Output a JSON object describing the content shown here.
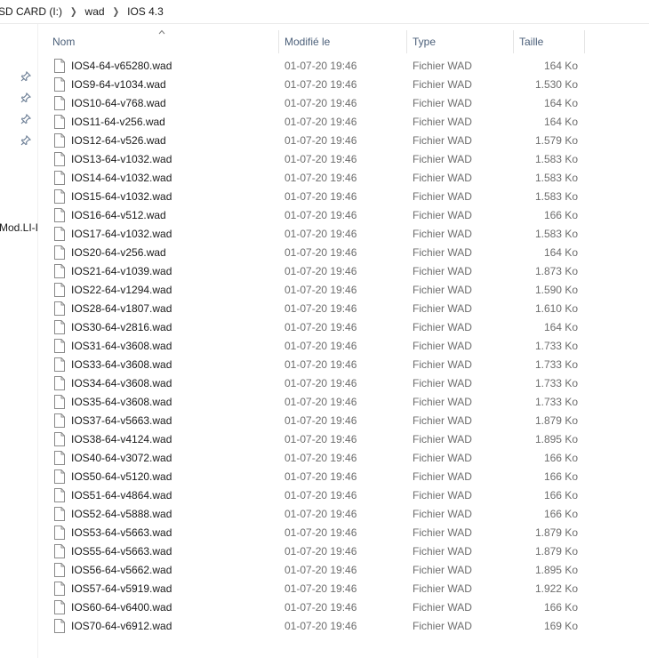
{
  "breadcrumb": [
    "SD CARD (I:)",
    "wad",
    "IOS 4.3"
  ],
  "nav": {
    "partial_label": "Mod.LI-I",
    "pins": 4
  },
  "columns": {
    "name": "Nom",
    "modified": "Modifié le",
    "type": "Type",
    "size": "Taille"
  },
  "files": [
    {
      "name": "IOS4-64-v65280.wad",
      "modified": "01-07-20 19:46",
      "type": "Fichier WAD",
      "size": "164 Ko"
    },
    {
      "name": "IOS9-64-v1034.wad",
      "modified": "01-07-20 19:46",
      "type": "Fichier WAD",
      "size": "1.530 Ko"
    },
    {
      "name": "IOS10-64-v768.wad",
      "modified": "01-07-20 19:46",
      "type": "Fichier WAD",
      "size": "164 Ko"
    },
    {
      "name": "IOS11-64-v256.wad",
      "modified": "01-07-20 19:46",
      "type": "Fichier WAD",
      "size": "164 Ko"
    },
    {
      "name": "IOS12-64-v526.wad",
      "modified": "01-07-20 19:46",
      "type": "Fichier WAD",
      "size": "1.579 Ko"
    },
    {
      "name": "IOS13-64-v1032.wad",
      "modified": "01-07-20 19:46",
      "type": "Fichier WAD",
      "size": "1.583 Ko"
    },
    {
      "name": "IOS14-64-v1032.wad",
      "modified": "01-07-20 19:46",
      "type": "Fichier WAD",
      "size": "1.583 Ko"
    },
    {
      "name": "IOS15-64-v1032.wad",
      "modified": "01-07-20 19:46",
      "type": "Fichier WAD",
      "size": "1.583 Ko"
    },
    {
      "name": "IOS16-64-v512.wad",
      "modified": "01-07-20 19:46",
      "type": "Fichier WAD",
      "size": "166 Ko"
    },
    {
      "name": "IOS17-64-v1032.wad",
      "modified": "01-07-20 19:46",
      "type": "Fichier WAD",
      "size": "1.583 Ko"
    },
    {
      "name": "IOS20-64-v256.wad",
      "modified": "01-07-20 19:46",
      "type": "Fichier WAD",
      "size": "164 Ko"
    },
    {
      "name": "IOS21-64-v1039.wad",
      "modified": "01-07-20 19:46",
      "type": "Fichier WAD",
      "size": "1.873 Ko"
    },
    {
      "name": "IOS22-64-v1294.wad",
      "modified": "01-07-20 19:46",
      "type": "Fichier WAD",
      "size": "1.590 Ko"
    },
    {
      "name": "IOS28-64-v1807.wad",
      "modified": "01-07-20 19:46",
      "type": "Fichier WAD",
      "size": "1.610 Ko"
    },
    {
      "name": "IOS30-64-v2816.wad",
      "modified": "01-07-20 19:46",
      "type": "Fichier WAD",
      "size": "164 Ko"
    },
    {
      "name": "IOS31-64-v3608.wad",
      "modified": "01-07-20 19:46",
      "type": "Fichier WAD",
      "size": "1.733 Ko"
    },
    {
      "name": "IOS33-64-v3608.wad",
      "modified": "01-07-20 19:46",
      "type": "Fichier WAD",
      "size": "1.733 Ko"
    },
    {
      "name": "IOS34-64-v3608.wad",
      "modified": "01-07-20 19:46",
      "type": "Fichier WAD",
      "size": "1.733 Ko"
    },
    {
      "name": "IOS35-64-v3608.wad",
      "modified": "01-07-20 19:46",
      "type": "Fichier WAD",
      "size": "1.733 Ko"
    },
    {
      "name": "IOS37-64-v5663.wad",
      "modified": "01-07-20 19:46",
      "type": "Fichier WAD",
      "size": "1.879 Ko"
    },
    {
      "name": "IOS38-64-v4124.wad",
      "modified": "01-07-20 19:46",
      "type": "Fichier WAD",
      "size": "1.895 Ko"
    },
    {
      "name": "IOS40-64-v3072.wad",
      "modified": "01-07-20 19:46",
      "type": "Fichier WAD",
      "size": "166 Ko"
    },
    {
      "name": "IOS50-64-v5120.wad",
      "modified": "01-07-20 19:46",
      "type": "Fichier WAD",
      "size": "166 Ko"
    },
    {
      "name": "IOS51-64-v4864.wad",
      "modified": "01-07-20 19:46",
      "type": "Fichier WAD",
      "size": "166 Ko"
    },
    {
      "name": "IOS52-64-v5888.wad",
      "modified": "01-07-20 19:46",
      "type": "Fichier WAD",
      "size": "166 Ko"
    },
    {
      "name": "IOS53-64-v5663.wad",
      "modified": "01-07-20 19:46",
      "type": "Fichier WAD",
      "size": "1.879 Ko"
    },
    {
      "name": "IOS55-64-v5663.wad",
      "modified": "01-07-20 19:46",
      "type": "Fichier WAD",
      "size": "1.879 Ko"
    },
    {
      "name": "IOS56-64-v5662.wad",
      "modified": "01-07-20 19:46",
      "type": "Fichier WAD",
      "size": "1.895 Ko"
    },
    {
      "name": "IOS57-64-v5919.wad",
      "modified": "01-07-20 19:46",
      "type": "Fichier WAD",
      "size": "1.922 Ko"
    },
    {
      "name": "IOS60-64-v6400.wad",
      "modified": "01-07-20 19:46",
      "type": "Fichier WAD",
      "size": "166 Ko"
    },
    {
      "name": "IOS70-64-v6912.wad",
      "modified": "01-07-20 19:46",
      "type": "Fichier WAD",
      "size": "169 Ko"
    }
  ],
  "colors": {
    "header_text": "#4c607a",
    "secondary_text": "#6d6d6d",
    "divider": "#e5e5e5"
  }
}
